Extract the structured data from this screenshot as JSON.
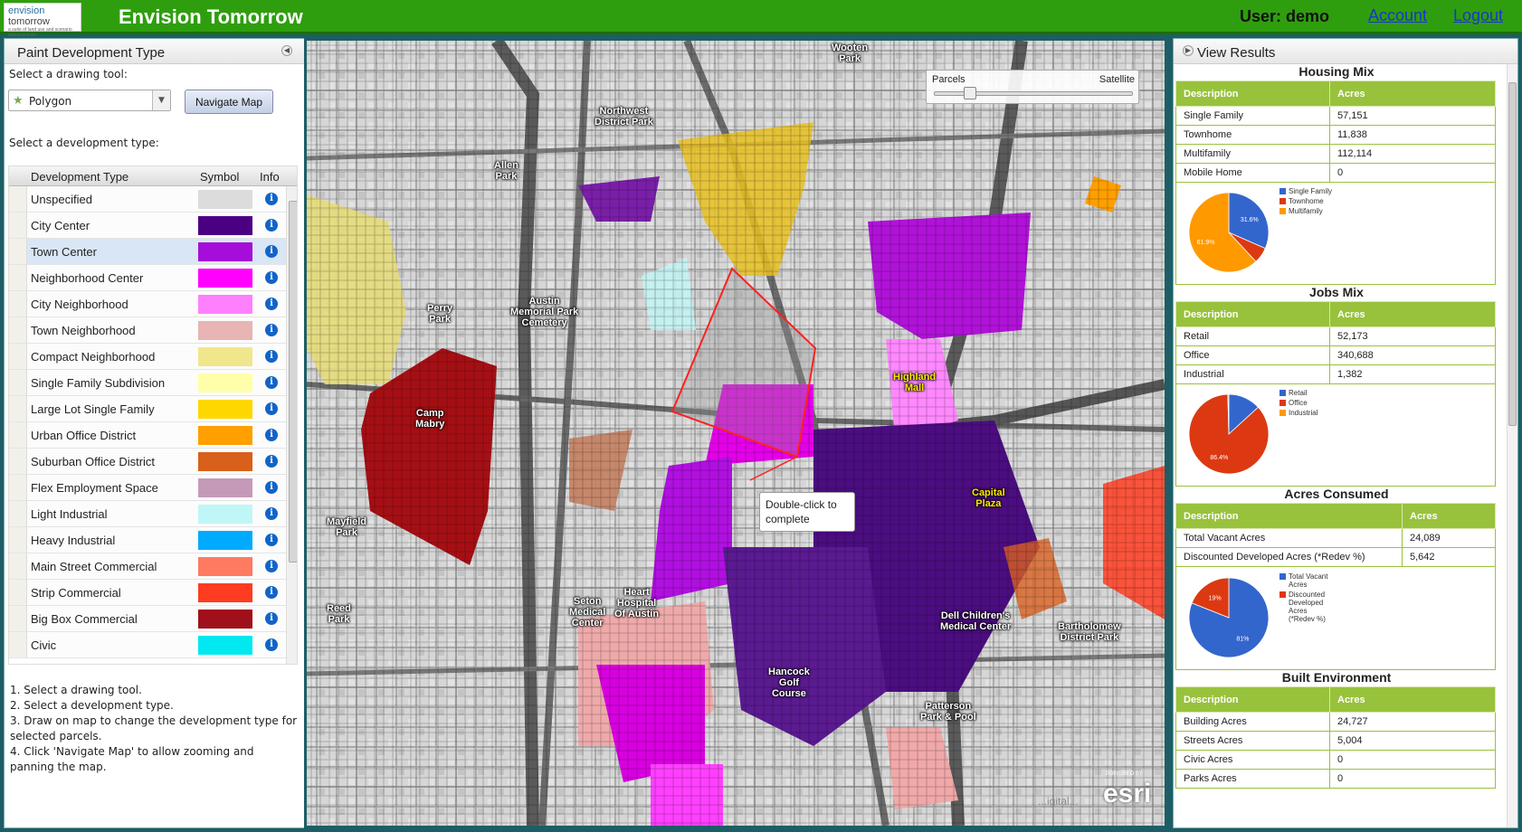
{
  "header": {
    "logo_line1": "envision",
    "logo_line2": "tomorrow",
    "logo_tagline": "a suite of land use and scenario planning tools",
    "title": "Envision Tomorrow",
    "user_label": "User: demo",
    "account_link": "Account",
    "logout_link": "Logout",
    "color": "#2f9e0e"
  },
  "left_panel": {
    "title": "Paint Development Type",
    "collapse_icon": "chevron-left-icon",
    "drawing_tool_label": "Select a drawing tool:",
    "drawing_tool_value": "Polygon",
    "navigate_button": "Navigate Map",
    "dev_type_label": "Select a development type:",
    "columns": [
      "Development Type",
      "Symbol",
      "Info"
    ],
    "selected_index": 2,
    "dev_types": [
      {
        "name": "Unspecified",
        "color": "#dcdcdc"
      },
      {
        "name": "City Center",
        "color": "#4b0082"
      },
      {
        "name": "Town Center",
        "color": "#a50dd8"
      },
      {
        "name": "Neighborhood Center",
        "color": "#ff00ff"
      },
      {
        "name": "City Neighborhood",
        "color": "#ff80ff"
      },
      {
        "name": "Town Neighborhood",
        "color": "#e8b4b4"
      },
      {
        "name": "Compact Neighborhood",
        "color": "#f0e68c"
      },
      {
        "name": "Single Family Subdivision",
        "color": "#ffffaa"
      },
      {
        "name": "Large Lot Single Family",
        "color": "#ffd700"
      },
      {
        "name": "Urban Office District",
        "color": "#ff9f00"
      },
      {
        "name": "Suburban Office District",
        "color": "#d8601a"
      },
      {
        "name": "Flex Employment Space",
        "color": "#c59ab8"
      },
      {
        "name": "Light Industrial",
        "color": "#c0f6f6"
      },
      {
        "name": "Heavy Industrial",
        "color": "#00aaff"
      },
      {
        "name": "Main Street Commercial",
        "color": "#ff7a60"
      },
      {
        "name": "Strip Commercial",
        "color": "#ff3c20"
      },
      {
        "name": "Big Box Commercial",
        "color": "#a0101a"
      },
      {
        "name": "Civic",
        "color": "#00e8f0"
      }
    ],
    "instructions": [
      "1. Select a drawing tool.",
      "2. Select a development type.",
      "3. Draw on map to change the development type for selected parcels.",
      "4. Click 'Navigate Map' to allow zooming and panning the map."
    ]
  },
  "map": {
    "slider_left": "Parcels",
    "slider_right": "Satellite",
    "slider_value": 0.18,
    "tooltip": "Double-click to complete",
    "esri_powered": "POWERED BY",
    "esri_logo": "esri",
    "attribution": "...igital...",
    "labels": [
      {
        "text": "Wooten\nPark",
        "color": "white"
      },
      {
        "text": "Northwest\nDistrict Park",
        "color": "white"
      },
      {
        "text": "Allen\nPark",
        "color": "white"
      },
      {
        "text": "Perry\nPark",
        "color": "white"
      },
      {
        "text": "Austin\nMemorial Park\nCemetery",
        "color": "white"
      },
      {
        "text": "Camp\nMabry",
        "color": "white"
      },
      {
        "text": "Highland\nMall",
        "color": "yellow"
      },
      {
        "text": "Capital\nPlaza",
        "color": "yellow"
      },
      {
        "text": "Mayfield\nPark",
        "color": "white"
      },
      {
        "text": "Reed\nPark",
        "color": "white"
      },
      {
        "text": "Seton\nMedical\nCenter",
        "color": "white"
      },
      {
        "text": "Heart\nHospital\nOf Austin",
        "color": "white"
      },
      {
        "text": "Dell Children's\nMedical Center",
        "color": "white"
      },
      {
        "text": "Bartholomew\nDistrict Park",
        "color": "white"
      },
      {
        "text": "Hancock\nGolf\nCourse",
        "color": "white"
      },
      {
        "text": "Patterson\nPark & Pool",
        "color": "white"
      }
    ]
  },
  "right_panel": {
    "title": "View Results",
    "collapse_icon": "chevron-right-icon",
    "housing": {
      "title": "Housing Mix",
      "headers": [
        "Description",
        "Acres"
      ],
      "rows": [
        [
          "Single Family",
          "57,151"
        ],
        [
          "Townhome",
          "11,838"
        ],
        [
          "Multifamily",
          "112,114"
        ],
        [
          "Mobile Home",
          "0"
        ]
      ],
      "pie": [
        {
          "label": "Single Family",
          "value": 31.6,
          "color": "#3366cc",
          "text": "31.6%"
        },
        {
          "label": "Townhome",
          "value": 6.5,
          "color": "#dc3912",
          "text": ""
        },
        {
          "label": "Multifamily",
          "value": 61.9,
          "color": "#ff9900",
          "text": "61.9%"
        }
      ]
    },
    "jobs": {
      "title": "Jobs Mix",
      "headers": [
        "Description",
        "Acres"
      ],
      "rows": [
        [
          "Retail",
          "52,173"
        ],
        [
          "Office",
          "340,688"
        ],
        [
          "Industrial",
          "1,382"
        ]
      ],
      "pie": [
        {
          "label": "Retail",
          "value": 13.2,
          "color": "#3366cc",
          "text": ""
        },
        {
          "label": "Office",
          "value": 86.4,
          "color": "#dc3912",
          "text": "86.4%"
        },
        {
          "label": "Industrial",
          "value": 0.4,
          "color": "#ff9900",
          "text": ""
        }
      ]
    },
    "acres": {
      "title": "Acres Consumed",
      "headers": [
        "Description",
        "Acres"
      ],
      "rows": [
        [
          "Total Vacant Acres",
          "24,089"
        ],
        [
          "Discounted Developed Acres (*Redev %)",
          "5,642"
        ]
      ],
      "pie": [
        {
          "label": "Total Vacant Acres",
          "value": 81,
          "color": "#3366cc",
          "text": "81%"
        },
        {
          "label": "Discounted Developed Acres (*Redev %)",
          "value": 19,
          "color": "#dc3912",
          "text": "19%"
        }
      ]
    },
    "built": {
      "title": "Built Environment",
      "headers": [
        "Description",
        "Acres"
      ],
      "rows": [
        [
          "Building Acres",
          "24,727"
        ],
        [
          "Streets Acres",
          "5,004"
        ],
        [
          "Civic Acres",
          "0"
        ],
        [
          "Parks Acres",
          "0"
        ]
      ]
    }
  }
}
